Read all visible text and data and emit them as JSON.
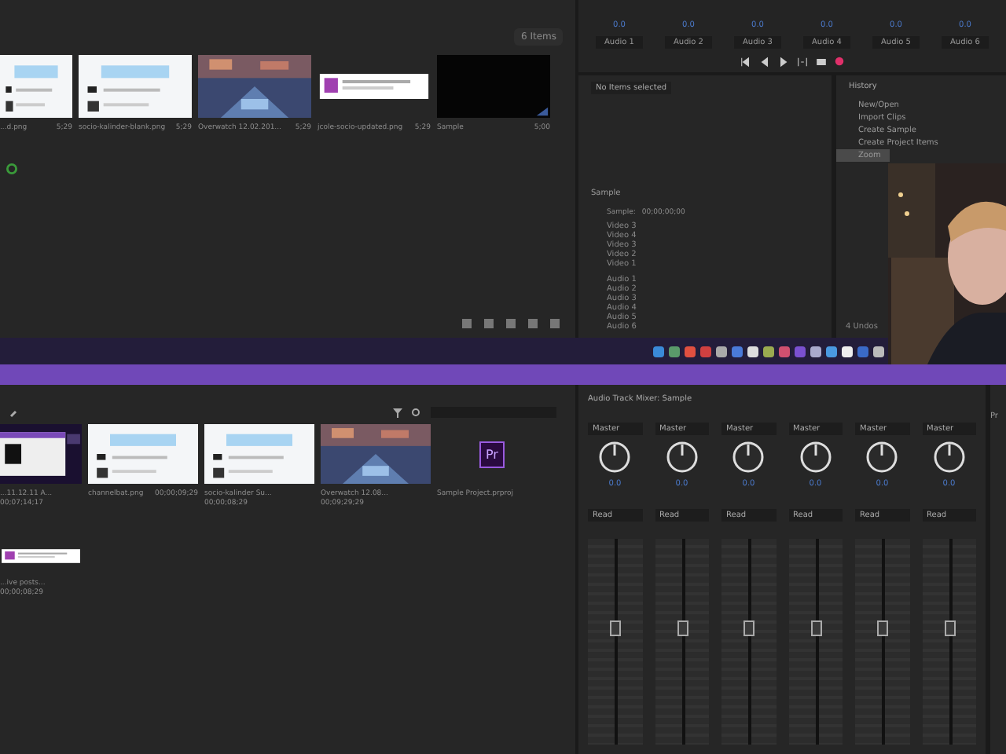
{
  "top_project": {
    "item_count": "6 Items",
    "items": [
      {
        "name": "...d.png",
        "duration": "5;29",
        "kind": "webpage"
      },
      {
        "name": "socio-kalinder-blank.png",
        "duration": "5;29",
        "kind": "webpage"
      },
      {
        "name": "Overwatch 12.02.201...",
        "duration": "5;29",
        "kind": "game"
      },
      {
        "name": "jcole-socio-updated.png",
        "duration": "5;29",
        "kind": "banner"
      },
      {
        "name": "Sample",
        "duration": "5;00",
        "kind": "black"
      }
    ]
  },
  "top_mixer": {
    "tracks": [
      {
        "name": "Audio 1",
        "reading": "0.0"
      },
      {
        "name": "Audio 2",
        "reading": "0.0"
      },
      {
        "name": "Audio 3",
        "reading": "0.0"
      },
      {
        "name": "Audio 4",
        "reading": "0.0"
      },
      {
        "name": "Audio 5",
        "reading": "0.0"
      },
      {
        "name": "Audio 6",
        "reading": "0.0"
      }
    ]
  },
  "info_panel": {
    "message": "No Items selected",
    "sequence": "Sample",
    "timecode_label": "Sample:",
    "timecode": "00;00;00;00",
    "tracks": [
      "Video 3",
      "Video 4",
      "Video 3",
      "Video 2",
      "Video 1",
      "Audio 1",
      "Audio 2",
      "Audio 3",
      "Audio 4",
      "Audio 5",
      "Audio 6"
    ]
  },
  "history": {
    "title": "History",
    "items": [
      {
        "label": "New/Open",
        "selected": false
      },
      {
        "label": "Import Clips",
        "selected": false
      },
      {
        "label": "Create Sample",
        "selected": false
      },
      {
        "label": "Create Project Items",
        "selected": false
      },
      {
        "label": "Zoom",
        "selected": true
      }
    ],
    "undos": "4 Undos"
  },
  "bottom_project": {
    "items": [
      {
        "name": "...11.12.11 A...",
        "duration": "00;07;14;17",
        "kind": "purple"
      },
      {
        "name": "channelbat.png",
        "duration": "00;00;09;29",
        "kind": "webpage"
      },
      {
        "name": "socio-kalinder Su...",
        "duration": "00;00;08;29",
        "kind": "webpage"
      },
      {
        "name": "Overwatch 12.08...",
        "duration": "00;09;29;29",
        "kind": "game"
      },
      {
        "name": "Sample Project.prproj",
        "kind": "project",
        "icon_text": "Pr"
      }
    ],
    "second_row": {
      "name": "...ive posts...",
      "duration": "00;00;08;29",
      "kind": "banner"
    }
  },
  "audio_mixer": {
    "title": "Audio Track Mixer: Sample",
    "channels": [
      {
        "output": "Master",
        "reading": "0.0",
        "automation": "Read",
        "level": 0.6
      },
      {
        "output": "Master",
        "reading": "0.0",
        "automation": "Read",
        "level": 0.6
      },
      {
        "output": "Master",
        "reading": "0.0",
        "automation": "Read",
        "level": 0.6
      },
      {
        "output": "Master",
        "reading": "0.0",
        "automation": "Read",
        "level": 0.6
      },
      {
        "output": "Master",
        "reading": "0.0",
        "automation": "Read",
        "level": 0.6
      },
      {
        "output": "Master",
        "reading": "0.0",
        "automation": "Read",
        "level": 0.6
      }
    ]
  },
  "side_tab": "Pr"
}
